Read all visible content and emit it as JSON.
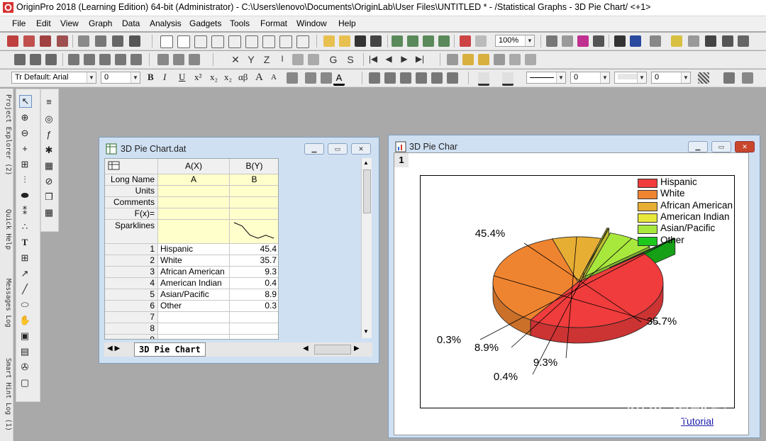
{
  "app": {
    "title": "OriginPro 2018 (Learning Edition) 64-bit (Administrator) - C:\\Users\\lenovo\\Documents\\OriginLab\\User Files\\UNTITLED * - /Statistical Graphs - 3D Pie Chart/ <+1>"
  },
  "menu": [
    "File",
    "Edit",
    "View",
    "Graph",
    "Data",
    "Analysis",
    "Gadgets",
    "Tools",
    "Format",
    "Window",
    "Help"
  ],
  "toolbar": {
    "zoom": "100%",
    "font": "Tr Default: Arial",
    "font_size": "0",
    "line_value_1": "0",
    "line_value_2": "0"
  },
  "format_labels": {
    "bold": "B",
    "italic": "I",
    "underline": "U",
    "sup": "x²",
    "sub": "x₂",
    "subsup": "x₂",
    "greek": "αβ",
    "bigger": "A",
    "smaller": "A"
  },
  "sidebar_tabs": [
    "Project Explorer (2)",
    "Quick Help",
    "Messages Log",
    "Smart Hint Log (1)"
  ],
  "worksheet": {
    "title": "3D Pie Chart.dat",
    "columns": [
      "A(X)",
      "B(Y)"
    ],
    "meta_rows": [
      {
        "label": "Long Name",
        "a": "A",
        "b": "B"
      },
      {
        "label": "Units",
        "a": "",
        "b": ""
      },
      {
        "label": "Comments",
        "a": "",
        "b": ""
      },
      {
        "label": "F(x)=",
        "a": "",
        "b": ""
      },
      {
        "label": "Sparklines",
        "a": "",
        "b": ""
      }
    ],
    "rows": [
      {
        "n": "1",
        "a": "Hispanic",
        "b": "45.4"
      },
      {
        "n": "2",
        "a": "White",
        "b": "35.7"
      },
      {
        "n": "3",
        "a": "African American",
        "b": "9.3"
      },
      {
        "n": "4",
        "a": "American Indian",
        "b": "0.4"
      },
      {
        "n": "5",
        "a": "Asian/Pacific",
        "b": "8.9"
      },
      {
        "n": "6",
        "a": "Other",
        "b": "0.3"
      },
      {
        "n": "7",
        "a": "",
        "b": ""
      },
      {
        "n": "8",
        "a": "",
        "b": ""
      },
      {
        "n": "9",
        "a": "",
        "b": ""
      }
    ],
    "sheet_tab": "3D Pie Chart"
  },
  "graph_window": {
    "title": "3D Pie Char",
    "layer": "1",
    "link": "Tutorial"
  },
  "chart_data": {
    "type": "pie",
    "categories": [
      "Hispanic",
      "White",
      "African American",
      "American Indian",
      "Asian/Pacific",
      "Other"
    ],
    "values": [
      45.4,
      35.7,
      9.3,
      0.4,
      8.9,
      0.3
    ],
    "labels": [
      "45.4%",
      "35.7%",
      "9.3%",
      "0.4%",
      "8.9%",
      "0.3%"
    ],
    "colors": [
      "#f03c3c",
      "#ef8430",
      "#e7ae34",
      "#e8e83c",
      "#a8e83c",
      "#1cc81c"
    ],
    "legend_position": "top-right",
    "style": "3D exploded"
  },
  "watermark": "知乎 @酸菜"
}
